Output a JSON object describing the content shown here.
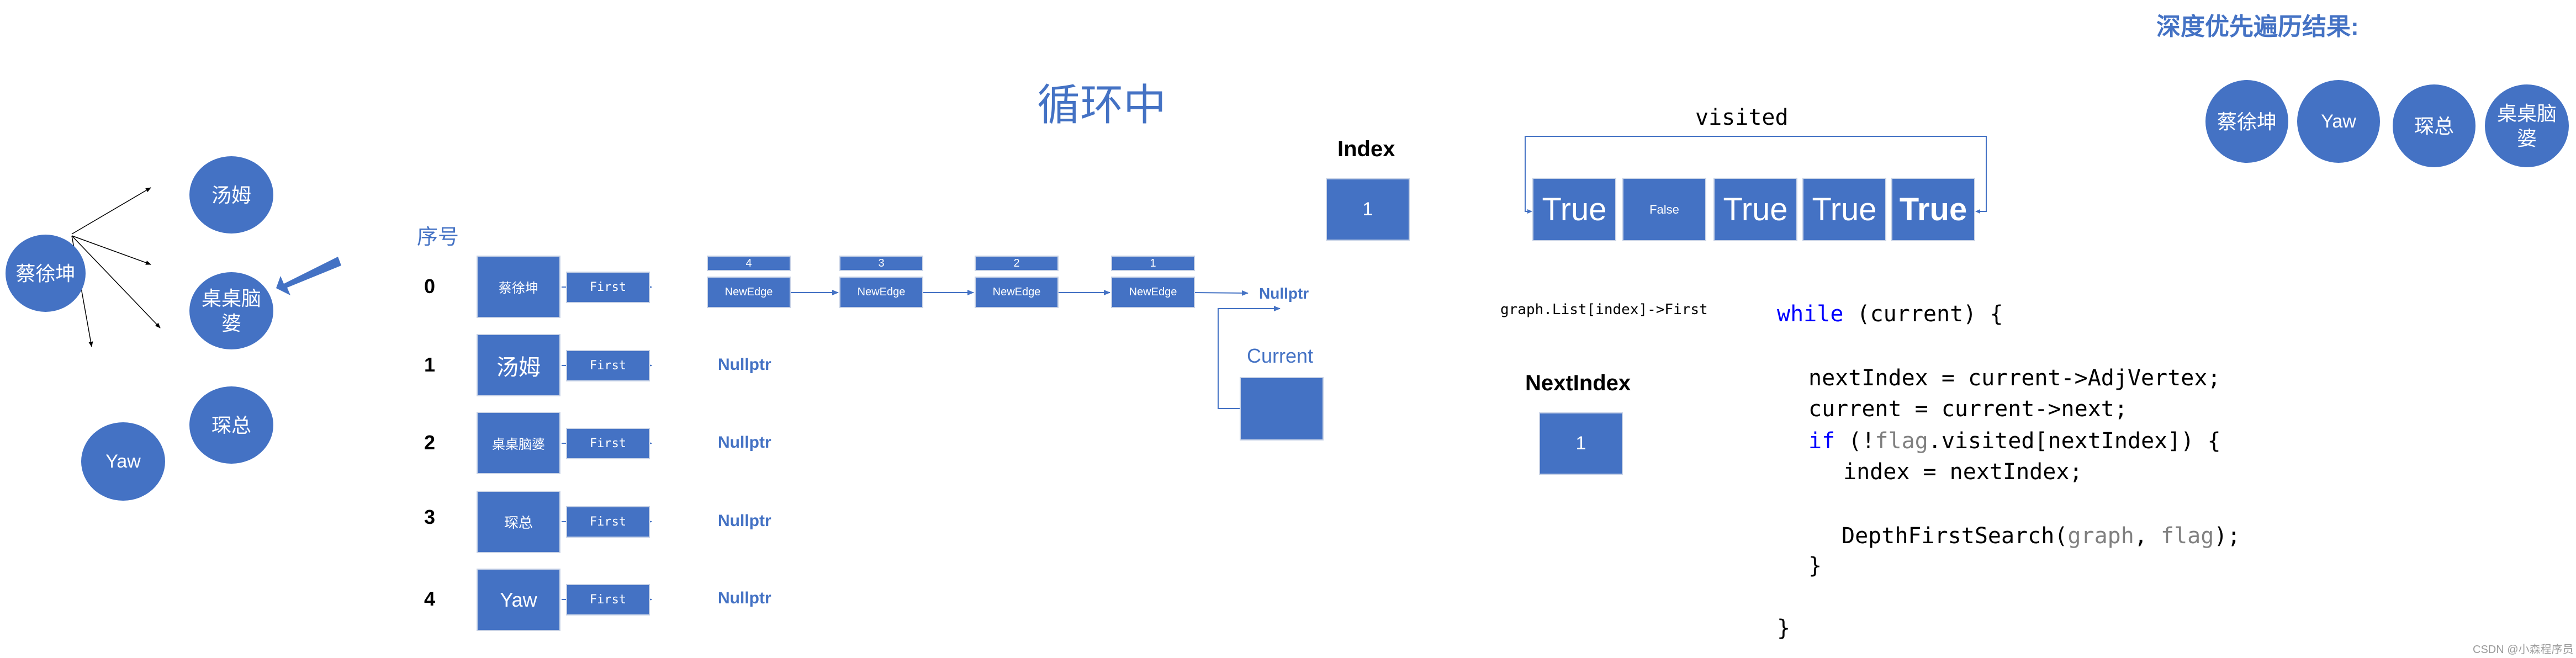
{
  "title": "循环中",
  "graph": {
    "nodes": [
      {
        "id": 0,
        "label": "蔡徐坤"
      },
      {
        "id": 1,
        "label": "汤姆"
      },
      {
        "id": 2,
        "label": "桌桌脑婆"
      },
      {
        "id": 3,
        "label": "琛总"
      },
      {
        "id": 4,
        "label": "Yaw"
      }
    ],
    "edges": [
      {
        "from": 0,
        "to": 1
      },
      {
        "from": 0,
        "to": 2
      },
      {
        "from": 0,
        "to": 3
      },
      {
        "from": 0,
        "to": 4
      }
    ],
    "highlight_arrow_target": "桌桌脑婆"
  },
  "adjacency_list": {
    "header": "序号",
    "first_label": "First",
    "edge_label": "NewEdge",
    "null_label": "Nullptr",
    "rows": [
      {
        "index": "0",
        "vertex": "蔡徐坤",
        "edges": [
          "4",
          "3",
          "2",
          "1"
        ]
      },
      {
        "index": "1",
        "vertex": "汤姆",
        "edges": []
      },
      {
        "index": "2",
        "vertex": "桌桌脑婆",
        "edges": []
      },
      {
        "index": "3",
        "vertex": "琛总",
        "edges": []
      },
      {
        "index": "4",
        "vertex": "Yaw",
        "edges": []
      }
    ]
  },
  "current": {
    "label": "Current",
    "value": ""
  },
  "index_var": {
    "label": "Index",
    "value": "1"
  },
  "next_index_var": {
    "label": "NextIndex",
    "value": "1"
  },
  "pointer_expr": "graph.List[index]->First",
  "visited": {
    "label": "visited",
    "cells": [
      "True",
      "False",
      "True",
      "True",
      "True"
    ]
  },
  "code": {
    "lines": [
      {
        "parts": [
          {
            "t": "while",
            "c": "kw"
          },
          {
            "t": " (current) {",
            "c": ""
          }
        ]
      },
      {
        "parts": [
          {
            "t": "  nextIndex = current->AdjVertex;",
            "c": ""
          }
        ]
      },
      {
        "parts": [
          {
            "t": "  current = current->next;",
            "c": ""
          }
        ]
      },
      {
        "parts": [
          {
            "t": "  ",
            "c": ""
          },
          {
            "t": "if",
            "c": "kw"
          },
          {
            "t": " (!",
            "c": ""
          },
          {
            "t": "flag",
            "c": "gray"
          },
          {
            "t": ".visited[nextIndex]) {",
            "c": ""
          }
        ]
      },
      {
        "parts": [
          {
            "t": "    index = nextIndex;",
            "c": ""
          }
        ]
      },
      {
        "parts": [
          {
            "t": "    DepthFirstSearch(",
            "c": ""
          },
          {
            "t": "graph",
            "c": "gray"
          },
          {
            "t": ", ",
            "c": ""
          },
          {
            "t": "flag",
            "c": "gray"
          },
          {
            "t": ");",
            "c": ""
          }
        ]
      },
      {
        "parts": [
          {
            "t": "  }",
            "c": ""
          }
        ]
      },
      {
        "parts": [
          {
            "t": "}",
            "c": ""
          }
        ]
      }
    ]
  },
  "dfs_result": {
    "title": "深度优先遍历结果:",
    "order": [
      "蔡徐坤",
      "Yaw",
      "琛总",
      "桌桌脑婆"
    ]
  },
  "watermark": "CSDN @小森程序员",
  "colors": {
    "accent": "#4472c4",
    "keyword": "#0000ff",
    "param": "#808080"
  }
}
